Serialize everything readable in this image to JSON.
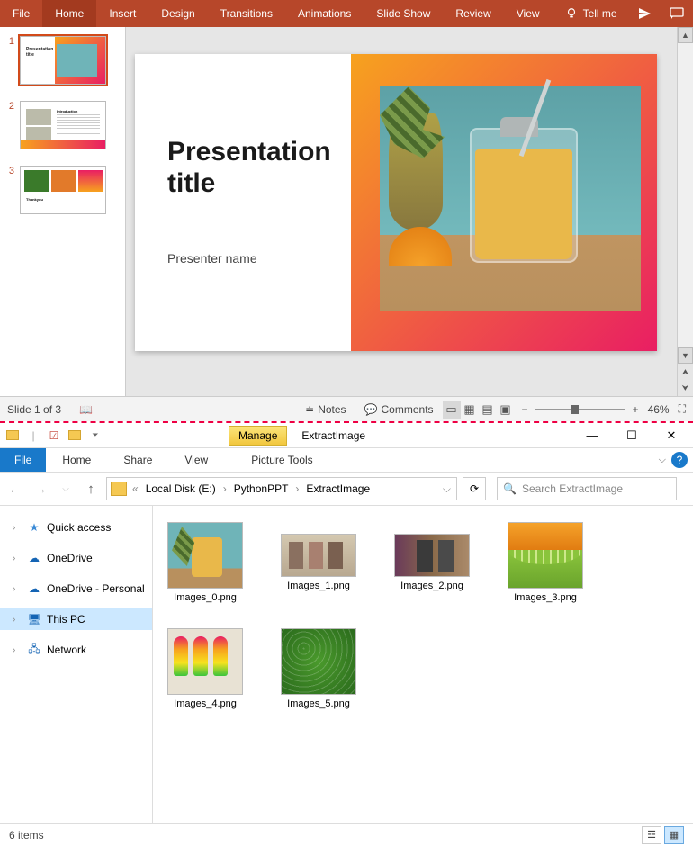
{
  "ppt": {
    "ribbon": {
      "tabs": [
        "File",
        "Home",
        "Insert",
        "Design",
        "Transitions",
        "Animations",
        "Slide Show",
        "Review",
        "View"
      ],
      "tellme": "Tell me"
    },
    "thumbs": [
      "1",
      "2",
      "3"
    ],
    "slide": {
      "title": "Presentation title",
      "subtitle": "Presenter name"
    },
    "status": {
      "slide_of": "Slide 1 of 3",
      "notes": "Notes",
      "comments": "Comments",
      "zoom": "46%"
    }
  },
  "fe": {
    "manage": "Manage",
    "title": "ExtractImage",
    "menus": {
      "file": "File",
      "home": "Home",
      "share": "Share",
      "view": "View",
      "pictools": "Picture Tools"
    },
    "breadcrumb": {
      "root": "Local Disk (E:)",
      "p1": "PythonPPT",
      "p2": "ExtractImage"
    },
    "search_placeholder": "Search ExtractImage",
    "nav": {
      "quick": "Quick access",
      "od": "OneDrive",
      "odp": "OneDrive - Personal",
      "thispc": "This PC",
      "network": "Network"
    },
    "files": [
      {
        "name": "Images_0.png"
      },
      {
        "name": "Images_1.png"
      },
      {
        "name": "Images_2.png"
      },
      {
        "name": "Images_3.png"
      },
      {
        "name": "Images_4.png"
      },
      {
        "name": "Images_5.png"
      }
    ],
    "status": "6 items"
  }
}
